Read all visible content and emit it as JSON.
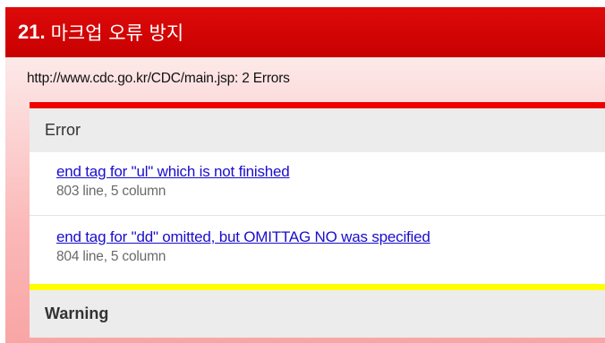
{
  "header": {
    "number": "21",
    "dot": ".",
    "title": "마크업 오류 방지"
  },
  "summary": {
    "url_line": "http://www.cdc.go.kr/CDC/main.jsp: 2 Errors"
  },
  "errors_section": {
    "heading": "Error",
    "items": [
      {
        "message": "end tag for \"ul\" which is not finished",
        "location": "803 line, 5 column"
      },
      {
        "message": "end tag for \"dd\" omitted, but OMITTAG NO was specified",
        "location": "804 line, 5 column"
      }
    ]
  },
  "warnings_section": {
    "heading": "Warning"
  },
  "colors": {
    "title_bar": "#d40000",
    "error_bar": "#ef0000",
    "warning_bar": "#ffff00",
    "link": "#1a0dcc"
  }
}
